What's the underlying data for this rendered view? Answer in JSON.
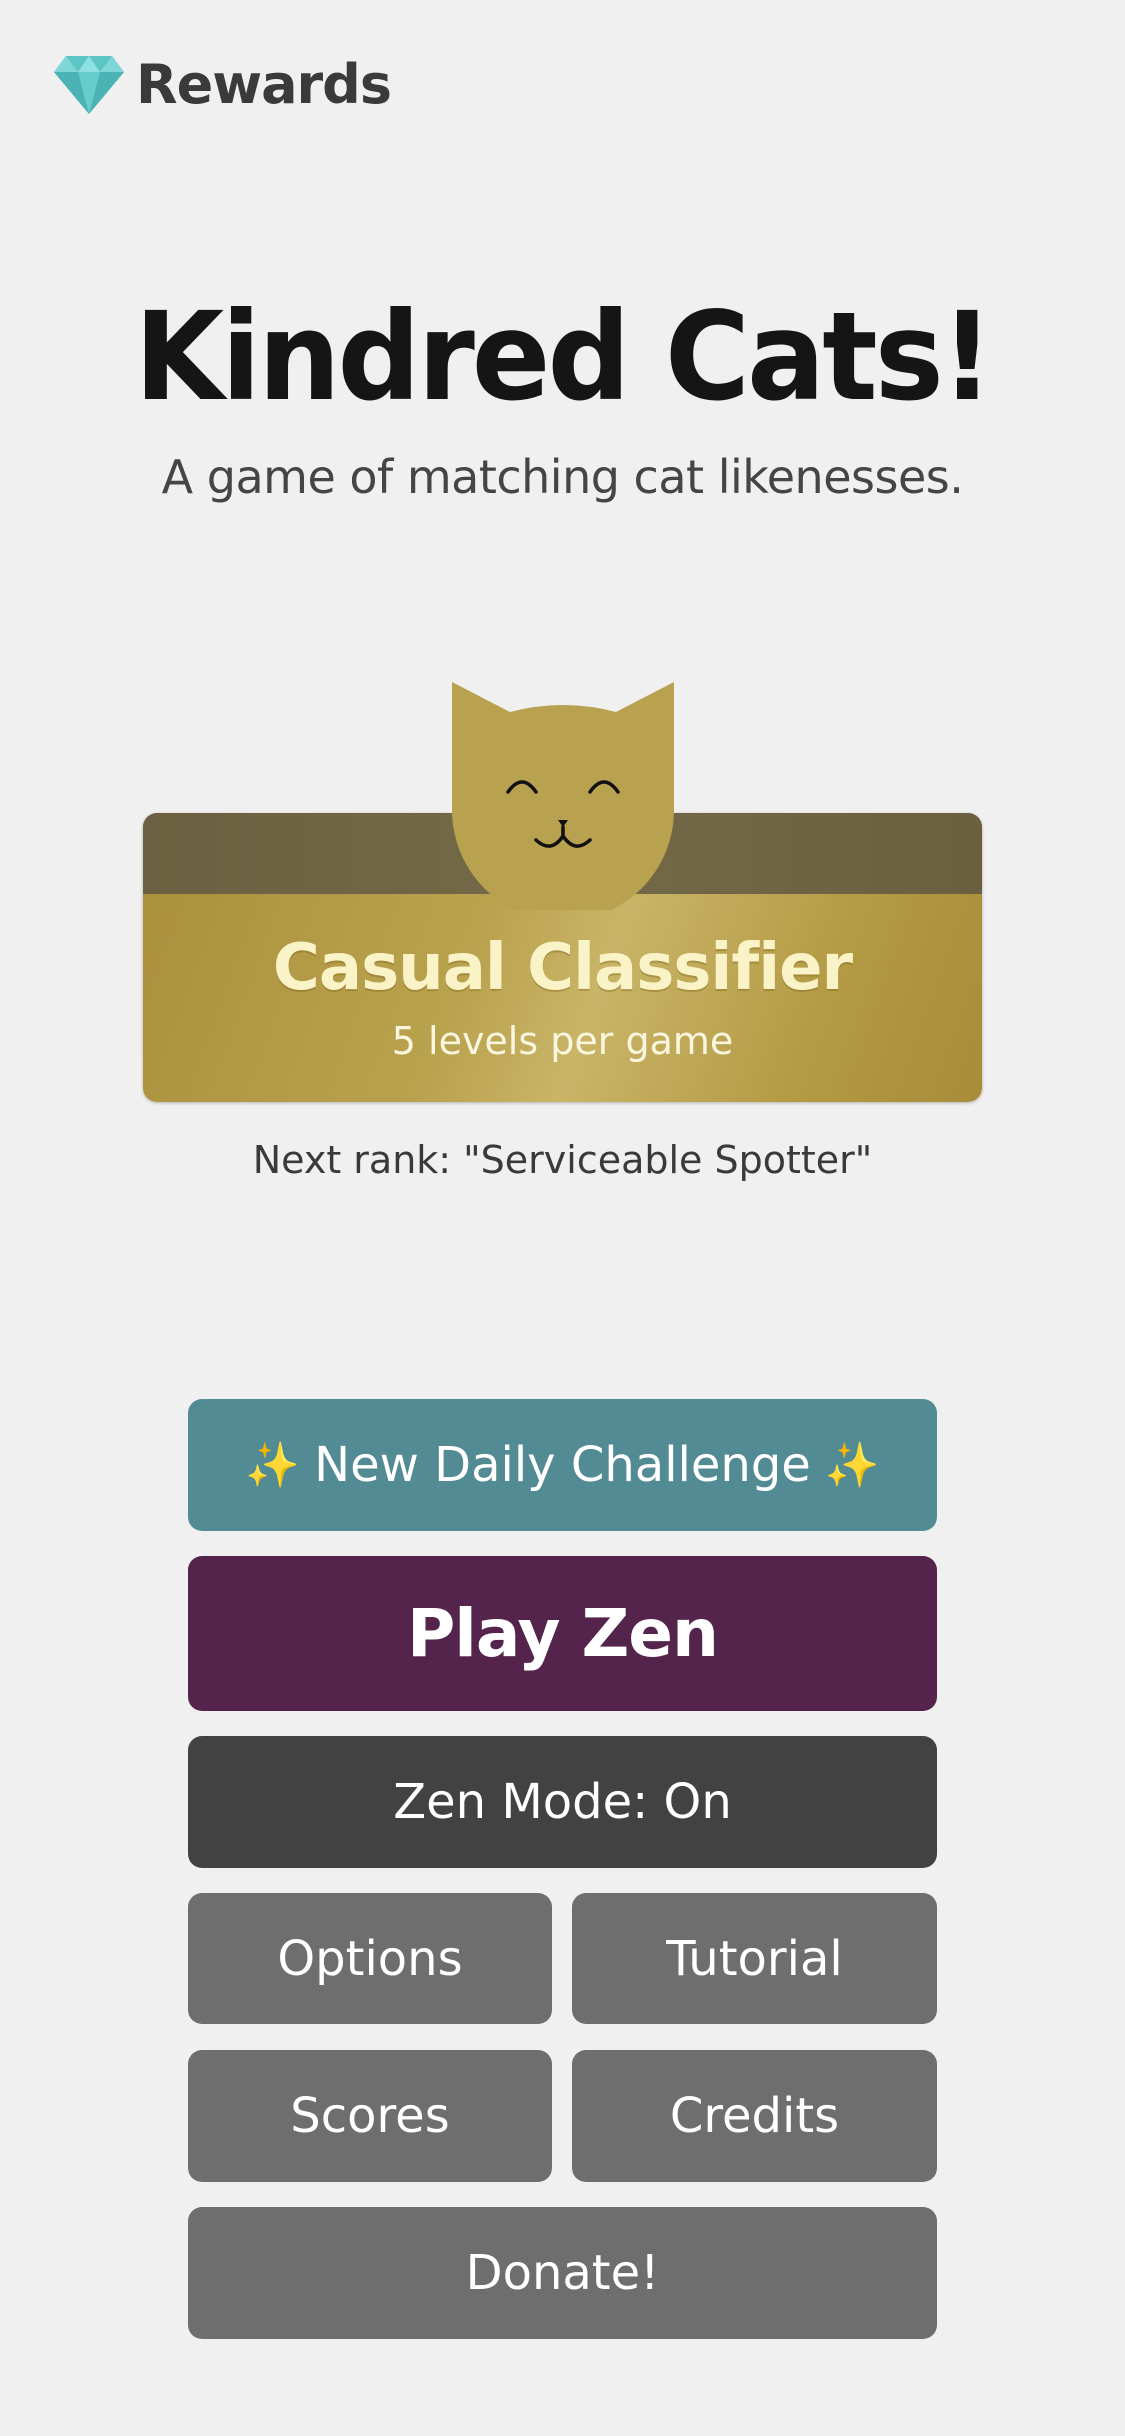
{
  "rewards": {
    "label": "Rewards",
    "icon": "diamond-icon",
    "icon_color": "#5cc5c5"
  },
  "title": "Kindred Cats!",
  "subtitle": "A game of matching cat likenesses.",
  "rank": {
    "name": "Casual Classifier",
    "detail": "5 levels per game",
    "next_rank": "Next rank: \"Serviceable Spotter\"",
    "avatar": "cat-face-icon",
    "card_color": "#b9a24e"
  },
  "buttons": {
    "daily_challenge": {
      "sparkle": "✨",
      "label": "New Daily Challenge"
    },
    "play_zen": "Play Zen",
    "zen_mode": "Zen Mode: On",
    "options": "Options",
    "tutorial": "Tutorial",
    "scores": "Scores",
    "credits": "Credits",
    "donate": "Donate!"
  },
  "colors": {
    "daily": "#538b95",
    "zen": "#54244d",
    "mode": "#424242",
    "secondary": "#6e6e6e",
    "background": "#f0f0f0"
  }
}
